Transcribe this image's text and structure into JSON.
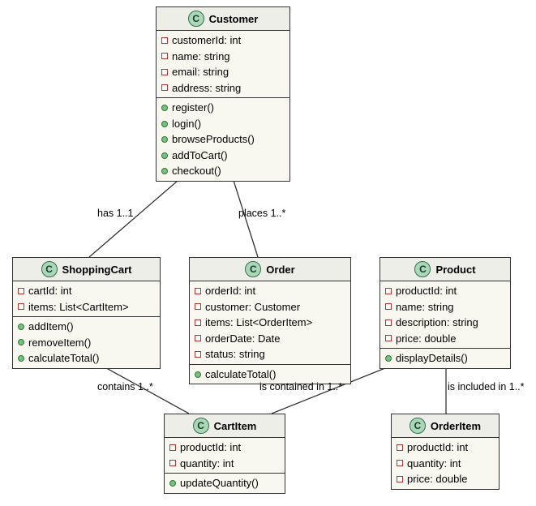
{
  "classes": {
    "customer": {
      "name": "Customer",
      "attrs": [
        {
          "vis": "private",
          "text": "customerId: int"
        },
        {
          "vis": "private",
          "text": "name: string"
        },
        {
          "vis": "private",
          "text": "email: string"
        },
        {
          "vis": "private",
          "text": "address: string"
        }
      ],
      "ops": [
        {
          "vis": "public",
          "text": "register()"
        },
        {
          "vis": "public",
          "text": "login()"
        },
        {
          "vis": "public",
          "text": "browseProducts()"
        },
        {
          "vis": "public",
          "text": "addToCart()"
        },
        {
          "vis": "public",
          "text": "checkout()"
        }
      ]
    },
    "shoppingcart": {
      "name": "ShoppingCart",
      "attrs": [
        {
          "vis": "private",
          "text": "cartId: int"
        },
        {
          "vis": "private",
          "text": "items: List<CartItem>"
        }
      ],
      "ops": [
        {
          "vis": "public",
          "text": "addItem()"
        },
        {
          "vis": "public",
          "text": "removeItem()"
        },
        {
          "vis": "public",
          "text": "calculateTotal()"
        }
      ]
    },
    "order": {
      "name": "Order",
      "attrs": [
        {
          "vis": "private",
          "text": "orderId: int"
        },
        {
          "vis": "private",
          "text": "customer: Customer"
        },
        {
          "vis": "private",
          "text": "items: List<OrderItem>"
        },
        {
          "vis": "private",
          "text": "orderDate: Date"
        },
        {
          "vis": "private",
          "text": "status: string"
        }
      ],
      "ops": [
        {
          "vis": "public",
          "text": "calculateTotal()"
        }
      ]
    },
    "product": {
      "name": "Product",
      "attrs": [
        {
          "vis": "private",
          "text": "productId: int"
        },
        {
          "vis": "private",
          "text": "name: string"
        },
        {
          "vis": "private",
          "text": "description: string"
        },
        {
          "vis": "private",
          "text": "price: double"
        }
      ],
      "ops": [
        {
          "vis": "public",
          "text": "displayDetails()"
        }
      ]
    },
    "cartitem": {
      "name": "CartItem",
      "attrs": [
        {
          "vis": "private",
          "text": "productId: int"
        },
        {
          "vis": "private",
          "text": "quantity: int"
        }
      ],
      "ops": [
        {
          "vis": "public",
          "text": "updateQuantity()"
        }
      ]
    },
    "orderitem": {
      "name": "OrderItem",
      "attrs": [
        {
          "vis": "private",
          "text": "productId: int"
        },
        {
          "vis": "private",
          "text": "quantity: int"
        },
        {
          "vis": "private",
          "text": "price: double"
        }
      ],
      "ops": []
    }
  },
  "edges": {
    "customer_cart": "has 1..1",
    "customer_order": "places 1..*",
    "cart_cartitem": "contains 1..*",
    "product_cartitem": "is contained in 1..*",
    "product_orderitem": "is included in 1..*"
  },
  "chart_data": {
    "type": "uml_class_diagram",
    "classes": [
      {
        "name": "Customer",
        "attributes": [
          "customerId: int",
          "name: string",
          "email: string",
          "address: string"
        ],
        "operations": [
          "register()",
          "login()",
          "browseProducts()",
          "addToCart()",
          "checkout()"
        ]
      },
      {
        "name": "ShoppingCart",
        "attributes": [
          "cartId: int",
          "items: List<CartItem>"
        ],
        "operations": [
          "addItem()",
          "removeItem()",
          "calculateTotal()"
        ]
      },
      {
        "name": "Order",
        "attributes": [
          "orderId: int",
          "customer: Customer",
          "items: List<OrderItem>",
          "orderDate: Date",
          "status: string"
        ],
        "operations": [
          "calculateTotal()"
        ]
      },
      {
        "name": "Product",
        "attributes": [
          "productId: int",
          "name: string",
          "description: string",
          "price: double"
        ],
        "operations": [
          "displayDetails()"
        ]
      },
      {
        "name": "CartItem",
        "attributes": [
          "productId: int",
          "quantity: int"
        ],
        "operations": [
          "updateQuantity()"
        ]
      },
      {
        "name": "OrderItem",
        "attributes": [
          "productId: int",
          "quantity: int",
          "price: double"
        ],
        "operations": []
      }
    ],
    "relations": [
      {
        "from": "Customer",
        "to": "ShoppingCart",
        "label": "has 1..1"
      },
      {
        "from": "Customer",
        "to": "Order",
        "label": "places 1..*"
      },
      {
        "from": "ShoppingCart",
        "to": "CartItem",
        "label": "contains 1..*"
      },
      {
        "from": "Product",
        "to": "CartItem",
        "label": "is contained in 1..*"
      },
      {
        "from": "Product",
        "to": "OrderItem",
        "label": "is included in 1..*"
      }
    ]
  }
}
